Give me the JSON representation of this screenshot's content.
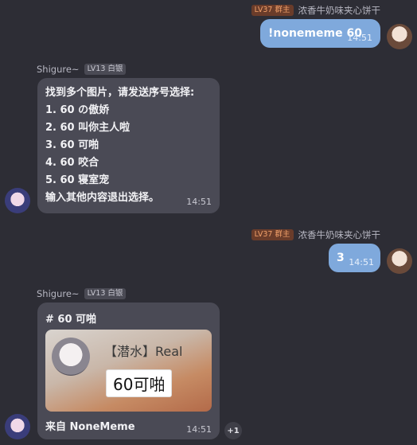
{
  "messages": [
    {
      "sender_name": "浓香牛奶味夹心饼干",
      "sender_badge": "LV37 群主",
      "text": "!nonememe 60",
      "time": "14:51"
    },
    {
      "sender_name": "Shigure~",
      "sender_badge": "LV13 白银",
      "lines": [
        "找到多个图片，请发送序号选择:",
        "1. 60 の傲娇",
        "2. 60 叫你主人啦",
        "3. 60 可啪",
        "4. 60 咬合",
        "5. 60 寝室宠",
        "输入其他内容退出选择。"
      ],
      "time": "14:51"
    },
    {
      "sender_name": "浓香牛奶味夹心饼干",
      "sender_badge": "LV37 群主",
      "text": "3",
      "time": "14:51"
    },
    {
      "sender_name": "Shigure~",
      "sender_badge": "LV13 白银",
      "heading": "# 60 可啪",
      "card_title": "【潜水】Real",
      "card_tag": "60可啪",
      "footer": "来自 NoneMeme",
      "time": "14:51",
      "reaction": "+1"
    }
  ],
  "colors": {
    "background": "#2d2d35",
    "my_bubble": "#7fa9dc",
    "bot_bubble": "#4a4a55",
    "owner_badge": "#f1a06a"
  },
  "icons": {
    "my_avatar": "user-avatar-icon",
    "bot_avatar": "bot-avatar-icon"
  }
}
